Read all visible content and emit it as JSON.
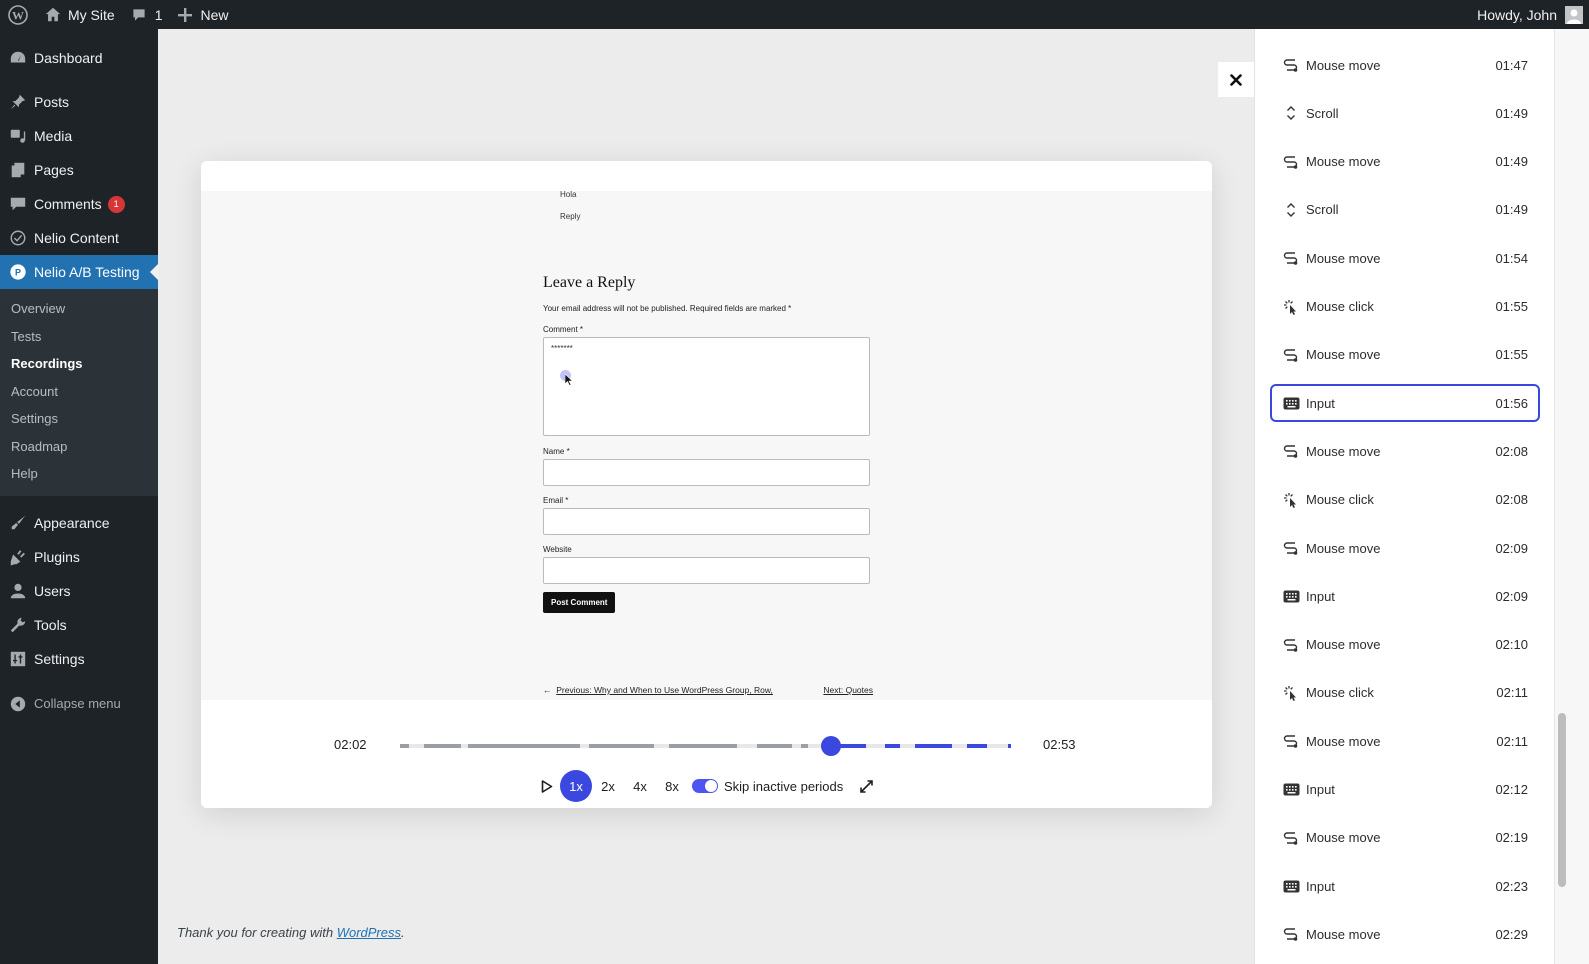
{
  "adminbar": {
    "site_name": "My Site",
    "comments_count": "1",
    "new_label": "New",
    "greeting": "Howdy, John"
  },
  "sidebar": {
    "items_top": [
      {
        "label": "Dashboard",
        "icon": "dashboard-icon"
      },
      {
        "label": "Posts",
        "icon": "pin-icon"
      },
      {
        "label": "Media",
        "icon": "media-icon"
      },
      {
        "label": "Pages",
        "icon": "pages-icon"
      },
      {
        "label": "Comments",
        "icon": "comment-icon",
        "badge": "1"
      },
      {
        "label": "Nelio Content",
        "icon": "nelio-content-icon"
      },
      {
        "label": "Nelio A/B Testing",
        "icon": "nelio-ab-icon",
        "current": true
      }
    ],
    "submenu": [
      {
        "label": "Overview"
      },
      {
        "label": "Tests"
      },
      {
        "label": "Recordings",
        "current": true
      },
      {
        "label": "Account"
      },
      {
        "label": "Settings"
      },
      {
        "label": "Roadmap"
      },
      {
        "label": "Help"
      }
    ],
    "items_bottom": [
      {
        "label": "Appearance",
        "icon": "brush-icon"
      },
      {
        "label": "Plugins",
        "icon": "plugin-icon"
      },
      {
        "label": "Users",
        "icon": "user-icon"
      },
      {
        "label": "Tools",
        "icon": "wrench-icon"
      },
      {
        "label": "Settings",
        "icon": "settings-icon"
      }
    ],
    "collapse_label": "Collapse menu"
  },
  "recording": {
    "page": {
      "comment_text": "Hola",
      "reply_link": "Reply",
      "heading": "Leave a Reply",
      "notice": "Your email address will not be published. Required fields are marked *",
      "comment_label": "Comment *",
      "comment_value": "*******",
      "name_label": "Name *",
      "email_label": "Email *",
      "website_label": "Website",
      "submit_label": "Post Comment",
      "prev_link": "Previous: Why and When to Use WordPress Group, Row,",
      "next_link": "Next: Quotes"
    },
    "player": {
      "current_time": "02:02",
      "total_time": "02:53",
      "progress": 0.705,
      "speeds": [
        "1x",
        "2x",
        "4x",
        "8x"
      ],
      "active_speed": "1x",
      "skip_inactive_label": "Skip inactive periods",
      "skip_inactive_enabled": true,
      "colors": {
        "played": "#9a9ea6",
        "remaining": "#3a48e0",
        "inactive": "#e8e8e8"
      }
    }
  },
  "footer": {
    "text": "Thank you for creating with ",
    "link": "WordPress",
    "suffix": "."
  },
  "events": [
    {
      "type": "Mouse move",
      "icon": "mouse-move-icon",
      "time": "01:47"
    },
    {
      "type": "Scroll",
      "icon": "scroll-icon",
      "time": "01:49"
    },
    {
      "type": "Mouse move",
      "icon": "mouse-move-icon",
      "time": "01:49"
    },
    {
      "type": "Scroll",
      "icon": "scroll-icon",
      "time": "01:49"
    },
    {
      "type": "Mouse move",
      "icon": "mouse-move-icon",
      "time": "01:54"
    },
    {
      "type": "Mouse click",
      "icon": "mouse-click-icon",
      "time": "01:55"
    },
    {
      "type": "Mouse move",
      "icon": "mouse-move-icon",
      "time": "01:55"
    },
    {
      "type": "Input",
      "icon": "keyboard-icon",
      "time": "01:56",
      "selected": true
    },
    {
      "type": "Mouse move",
      "icon": "mouse-move-icon",
      "time": "02:08"
    },
    {
      "type": "Mouse click",
      "icon": "mouse-click-icon",
      "time": "02:08"
    },
    {
      "type": "Mouse move",
      "icon": "mouse-move-icon",
      "time": "02:09"
    },
    {
      "type": "Input",
      "icon": "keyboard-icon",
      "time": "02:09"
    },
    {
      "type": "Mouse move",
      "icon": "mouse-move-icon",
      "time": "02:10"
    },
    {
      "type": "Mouse click",
      "icon": "mouse-click-icon",
      "time": "02:11"
    },
    {
      "type": "Mouse move",
      "icon": "mouse-move-icon",
      "time": "02:11"
    },
    {
      "type": "Input",
      "icon": "keyboard-icon",
      "time": "02:12"
    },
    {
      "type": "Mouse move",
      "icon": "mouse-move-icon",
      "time": "02:19"
    },
    {
      "type": "Input",
      "icon": "keyboard-icon",
      "time": "02:23"
    },
    {
      "type": "Mouse move",
      "icon": "mouse-move-icon",
      "time": "02:29"
    }
  ]
}
